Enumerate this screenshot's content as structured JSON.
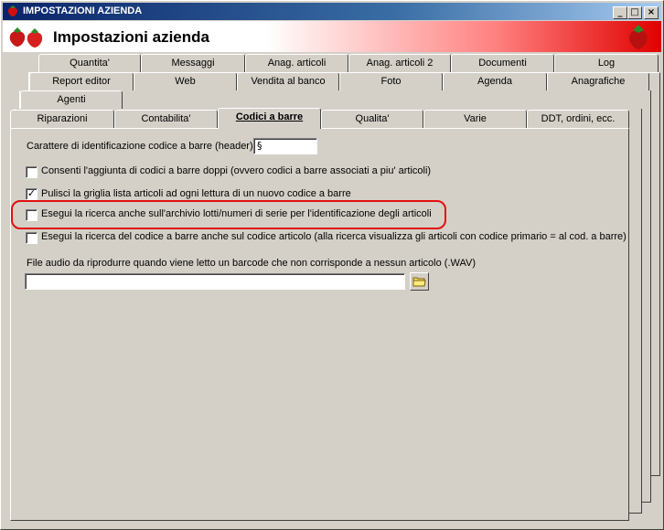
{
  "window": {
    "title": "IMPOSTAZIONI AZIENDA",
    "minimize": "_",
    "maximize": "□",
    "close": "×"
  },
  "header": {
    "title": "Impostazioni azienda"
  },
  "tabs": {
    "row1": [
      "Quantita'",
      "Messaggi",
      "Anag. articoli",
      "Anag. articoli 2",
      "Documenti",
      "Log"
    ],
    "row2": [
      "Report editor",
      "Web",
      "Vendita al banco",
      "Foto",
      "Agenda",
      "Anagrafiche"
    ],
    "row3": [
      "Agenti"
    ],
    "row4": [
      "Riparazioni",
      "Contabilita'",
      "Codici a barre",
      "Qualita'",
      "Varie",
      "DDT, ordini, ecc."
    ]
  },
  "form": {
    "header_label": "Carattere di identificazione codice a barre (header) :",
    "header_value": "§",
    "options": [
      {
        "label": "Consenti l'aggiunta di codici a barre doppi (ovvero codici a barre associati a piu' articoli)",
        "checked": false
      },
      {
        "label": "Pulisci la griglia lista articoli ad ogni lettura di un nuovo codice a barre",
        "checked": true
      },
      {
        "label": "Esegui la ricerca anche sull'archivio lotti/numeri di serie per l'identificazione degli articoli",
        "checked": false
      },
      {
        "label": "Esegui la ricerca del codice a barre anche sul codice articolo (alla ricerca visualizza gli articoli con codice primario = al cod. a barre)",
        "checked": false
      }
    ],
    "audio_label": "File audio da riprodurre quando viene letto un barcode che non corrisponde a nessun articolo (.WAV)",
    "audio_value": ""
  },
  "colors": {
    "highlight": "#e01010",
    "title_bar": "#0a246a"
  }
}
